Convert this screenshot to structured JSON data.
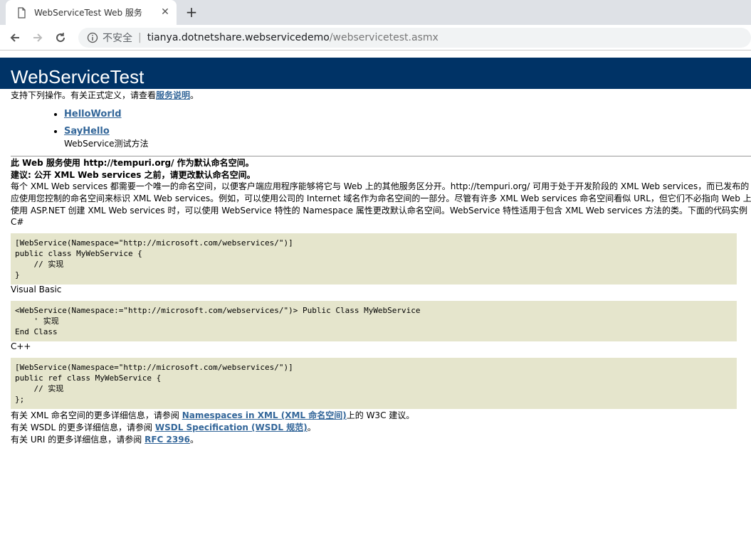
{
  "browser": {
    "tab_title": "WebServiceTest Web 服务",
    "security_label": "不安全",
    "url_host": "tianya.dotnetshare.webservicedemo",
    "url_path": "/webservicetest.asmx"
  },
  "page": {
    "heading": "WebServiceTest",
    "intro_text": "支持下列操作。有关正式定义，请查看",
    "intro_link": "服务说明",
    "intro_end": "。",
    "operations": [
      {
        "name": "HelloWorld",
        "desc": ""
      },
      {
        "name": "SayHello",
        "desc": "WebService测试方法"
      }
    ],
    "namespace_note": "此 Web 服务使用 http://tempuri.org/ 作为默认命名空间。",
    "recommendation": "建议: 公开 XML Web services 之前，请更改默认命名空间。",
    "para1": "每个 XML Web services 都需要一个唯一的命名空间，以便客户端应用程序能够将它与 Web 上的其他服务区分开。http://tempuri.org/ 可用于处于开发阶段的 XML Web services，而已发布的",
    "para2": "应使用您控制的命名空间来标识 XML Web services。例如，可以使用公司的 Internet 域名作为命名空间的一部分。尽管有许多 XML Web services 命名空间看似 URL，但它们不必指向 Web 上",
    "para3": "使用 ASP.NET 创建 XML Web services 时，可以使用 WebService 特性的 Namespace 属性更改默认命名空间。WebService 特性适用于包含 XML Web services 方法的类。下面的代码实例",
    "code_samples": [
      {
        "lang": "C#",
        "code": "[WebService(Namespace=\"http://microsoft.com/webservices/\")]\npublic class MyWebService {\n    // 实现\n}"
      },
      {
        "lang": "Visual Basic",
        "code": "<WebService(Namespace:=\"http://microsoft.com/webservices/\")> Public Class MyWebService\n    ' 实现\nEnd Class"
      },
      {
        "lang": "C++",
        "code": "[WebService(Namespace=\"http://microsoft.com/webservices/\")]\npublic ref class MyWebService {\n    // 实现\n};"
      }
    ],
    "footer": [
      {
        "pre": "有关 XML 命名空间的更多详细信息，请参阅 ",
        "link": "Namespaces in XML (XML 命名空间)",
        "post": "上的 W3C 建议。"
      },
      {
        "pre": "有关 WSDL 的更多详细信息，请参阅 ",
        "link": "WSDL Specification (WSDL 规范)",
        "post": "。"
      },
      {
        "pre": "有关 URI 的更多详细信息，请参阅 ",
        "link": "RFC 2396",
        "post": "。"
      }
    ]
  }
}
